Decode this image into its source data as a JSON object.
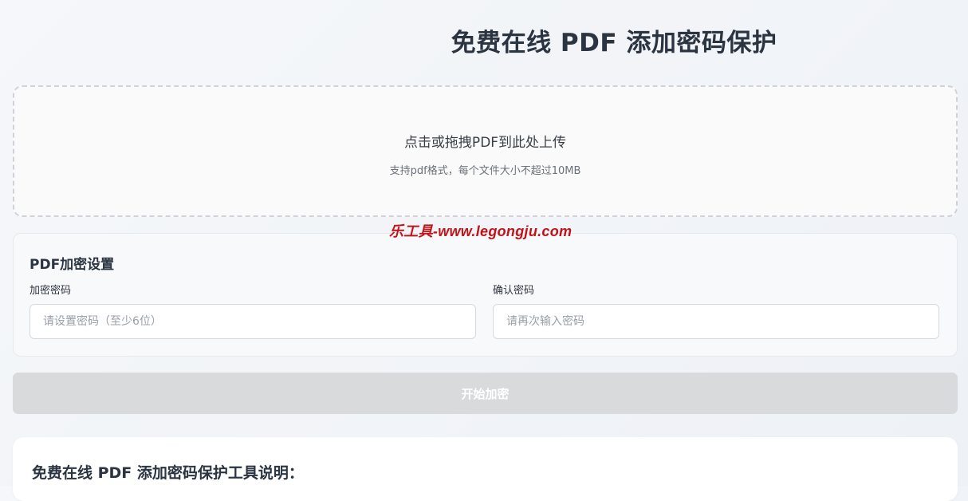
{
  "page": {
    "title": "免费在线 PDF 添加密码保护"
  },
  "upload": {
    "main_text": "点击或拖拽PDF到此处上传",
    "sub_text": "支持pdf格式，每个文件大小不超过10MB"
  },
  "watermark": {
    "text": "乐工具-www.legongju.com",
    "color": "#c0141a"
  },
  "settings": {
    "title": "PDF加密设置",
    "password_label": "加密密码",
    "password_placeholder": "请设置密码（至少6位）",
    "password_value": "",
    "confirm_label": "确认密码",
    "confirm_placeholder": "请再次输入密码",
    "confirm_value": ""
  },
  "actions": {
    "encrypt_label": "开始加密",
    "encrypt_enabled": false
  },
  "info": {
    "title": "免费在线 PDF 添加密码保护工具说明："
  }
}
